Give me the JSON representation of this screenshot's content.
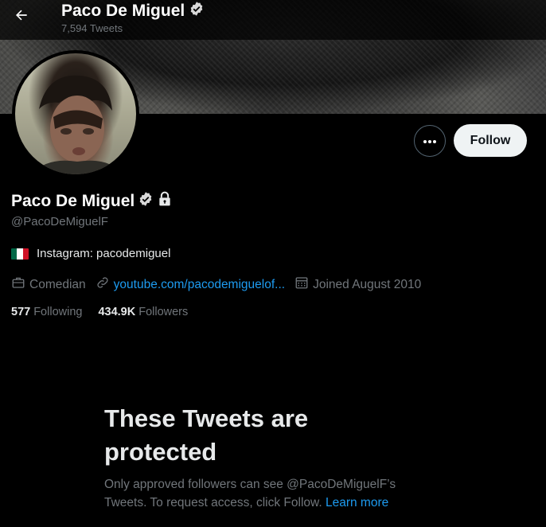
{
  "header": {
    "name": "Paco De Miguel",
    "tweet_count": "7,594 Tweets",
    "back_icon": "arrow-left-icon"
  },
  "profile": {
    "name": "Paco De Miguel",
    "handle": "@PacoDeMiguelF",
    "verified": true,
    "protected": true,
    "bio_flag": "mexico-flag-icon",
    "bio": "Instagram: pacodemiguel",
    "category": "Comedian",
    "website": "youtube.com/pacodemiguelof...",
    "joined": "Joined August 2010"
  },
  "stats": {
    "following_count": "577",
    "following_label": "Following",
    "followers_count": "434.9K",
    "followers_label": "Followers"
  },
  "actions": {
    "follow_label": "Follow",
    "more_icon": "more-dots-icon"
  },
  "protected_notice": {
    "title": "These Tweets are protected",
    "body": "Only approved followers can see @PacoDeMiguelF’s Tweets. To request access, click Follow.",
    "learn_more": "Learn more"
  },
  "colors": {
    "background": "#000000",
    "accent": "#1d9bf0",
    "secondary_text": "#71767b",
    "primary_text": "#e7e9ea",
    "follow_button_bg": "#eff3f4"
  }
}
